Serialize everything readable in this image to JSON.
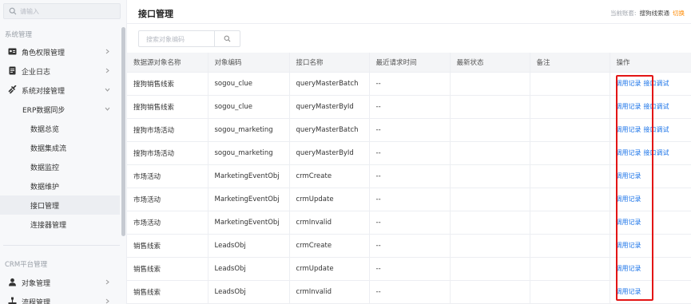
{
  "sidebar": {
    "search_placeholder": "请输入",
    "section_system": "系统管理",
    "section_crm": "CRM平台管理",
    "items": [
      {
        "label": "角色权限管理"
      },
      {
        "label": "企业日志"
      },
      {
        "label": "系统对接管理"
      },
      {
        "label": "ERP数据同步"
      },
      {
        "label": "数据总览"
      },
      {
        "label": "数据集成流"
      },
      {
        "label": "数据监控"
      },
      {
        "label": "数据维护"
      },
      {
        "label": "接口管理"
      },
      {
        "label": "连接器管理"
      },
      {
        "label": "对象管理"
      },
      {
        "label": "流程管理"
      }
    ]
  },
  "header": {
    "title": "接口管理",
    "account_label": "当前账套:",
    "account_value": "搜狗线索通",
    "switch_label": "切换"
  },
  "toolbar": {
    "search_placeholder": "搜索对象编码"
  },
  "table": {
    "columns": [
      "数据源对象名称",
      "对象编码",
      "接口名称",
      "最近请求时间",
      "最新状态",
      "备注",
      "操作"
    ],
    "rows": [
      {
        "name": "搜狗销售线索",
        "code": "sogou_clue",
        "api": "queryMasterBatch",
        "time": "--",
        "status": "",
        "note": "",
        "log": "调用记录",
        "test": "接口调试"
      },
      {
        "name": "搜狗销售线索",
        "code": "sogou_clue",
        "api": "queryMasterById",
        "time": "--",
        "status": "",
        "note": "",
        "log": "调用记录",
        "test": "接口调试"
      },
      {
        "name": "搜狗市场活动",
        "code": "sogou_marketing",
        "api": "queryMasterBatch",
        "time": "--",
        "status": "",
        "note": "",
        "log": "调用记录",
        "test": "接口调试"
      },
      {
        "name": "搜狗市场活动",
        "code": "sogou_marketing",
        "api": "queryMasterById",
        "time": "--",
        "status": "",
        "note": "",
        "log": "调用记录",
        "test": "接口调试"
      },
      {
        "name": "市场活动",
        "code": "MarketingEventObj",
        "api": "crmCreate",
        "time": "--",
        "status": "",
        "note": "",
        "log": "调用记录",
        "test": ""
      },
      {
        "name": "市场活动",
        "code": "MarketingEventObj",
        "api": "crmUpdate",
        "time": "--",
        "status": "",
        "note": "",
        "log": "调用记录",
        "test": ""
      },
      {
        "name": "市场活动",
        "code": "MarketingEventObj",
        "api": "crmInvalid",
        "time": "--",
        "status": "",
        "note": "",
        "log": "调用记录",
        "test": ""
      },
      {
        "name": "销售线索",
        "code": "LeadsObj",
        "api": "crmCreate",
        "time": "--",
        "status": "",
        "note": "",
        "log": "调用记录",
        "test": ""
      },
      {
        "name": "销售线索",
        "code": "LeadsObj",
        "api": "crmUpdate",
        "time": "--",
        "status": "",
        "note": "",
        "log": "调用记录",
        "test": ""
      },
      {
        "name": "销售线索",
        "code": "LeadsObj",
        "api": "crmInvalid",
        "time": "--",
        "status": "",
        "note": "",
        "log": "调用记录",
        "test": ""
      }
    ]
  },
  "colors": {
    "link": "#1a73e8",
    "switch": "#ff8a00",
    "highlight": "#e31515"
  }
}
